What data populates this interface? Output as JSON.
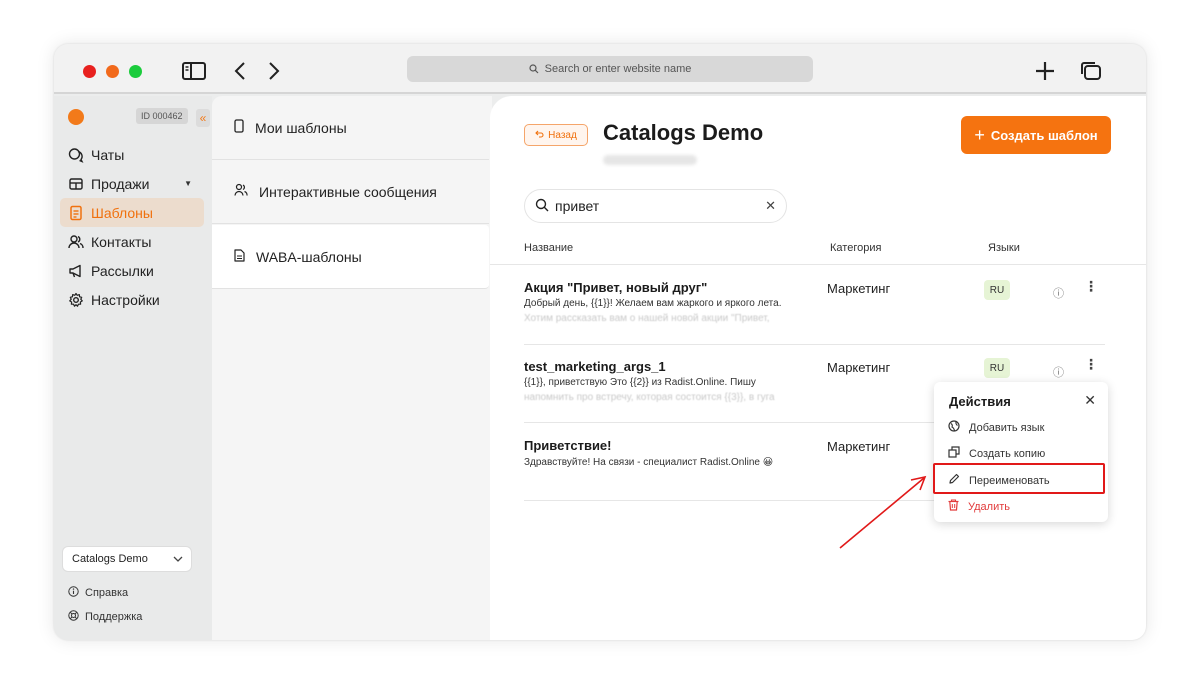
{
  "browser": {
    "address_placeholder": "Search or enter website name"
  },
  "sidebar": {
    "id_badge": "ID 000462",
    "collapse_glyph": "«",
    "items": [
      {
        "label": "Чаты",
        "icon": "chat-icon",
        "active": false
      },
      {
        "label": "Продажи",
        "icon": "sales-icon",
        "active": false
      },
      {
        "label": "Шаблоны",
        "icon": "template-icon",
        "active": true
      },
      {
        "label": "Контакты",
        "icon": "contacts-icon",
        "active": false
      },
      {
        "label": "Рассылки",
        "icon": "broadcast-icon",
        "active": false
      },
      {
        "label": "Настройки",
        "icon": "gear-icon",
        "active": false
      }
    ],
    "project_select": "Catalogs Demo",
    "help_label": "Справка",
    "support_label": "Поддержка"
  },
  "middle": {
    "items": [
      {
        "label": "Мои шаблоны",
        "active": false
      },
      {
        "label": "Интерактивные сообщения",
        "active": false
      },
      {
        "label": "WABA-шаблоны",
        "active": true
      }
    ]
  },
  "main": {
    "back_label": "Назад",
    "title": "Catalogs Demo",
    "create_label": "Создать шаблон",
    "search_value": "привет",
    "columns": {
      "name": "Название",
      "category": "Категория",
      "languages": "Языки"
    },
    "rows": [
      {
        "title": "Акция \"Привет, новый друг\"",
        "desc": "Добрый день, {{1}}! Желаем вам жаркого и яркого лета.",
        "desc2": "Хотим рассказать вам о нашей новой акции \"Привет,",
        "category": "Маркетинг",
        "lang": "RU"
      },
      {
        "title": "test_marketing_args_1",
        "desc": "{{1}}, приветствую Это {{2}} из Radist.Online. Пишу",
        "desc2": "напомнить про встречу, которая состоится {{3}}, в гуга",
        "category": "Маркетинг",
        "lang": "RU"
      },
      {
        "title": "Приветствие!",
        "desc": "Здравствуйте! На связи - специалист Radist.Online 😀",
        "desc2": "",
        "category": "Маркетинг",
        "lang": ""
      }
    ]
  },
  "actions_popup": {
    "title": "Действия",
    "items": [
      {
        "label": "Добавить язык",
        "icon": "globe-icon"
      },
      {
        "label": "Создать копию",
        "icon": "copy-icon"
      },
      {
        "label": "Переименовать",
        "icon": "pencil-icon"
      },
      {
        "label": "Удалить",
        "icon": "trash-icon"
      }
    ]
  },
  "colors": {
    "accent": "#f57310",
    "highlight": "#e11919",
    "danger": "#e23b3b"
  }
}
